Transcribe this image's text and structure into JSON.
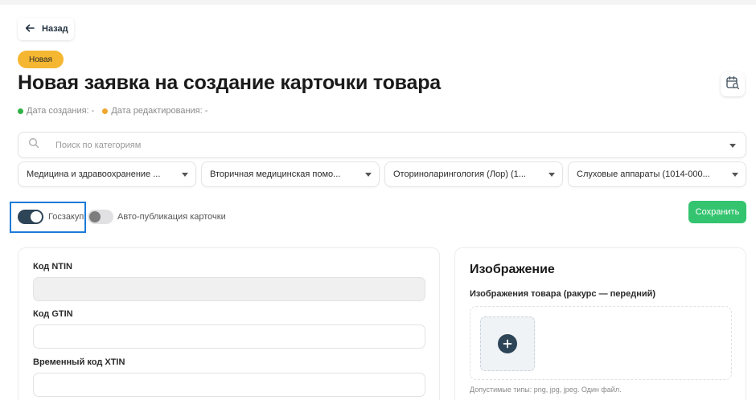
{
  "header": {
    "back_label": "Назад",
    "status_badge": "Новая",
    "title": "Новая заявка на создание карточки товара",
    "created_label": "Дата создания: -",
    "edited_label": "Дата редактирования: -"
  },
  "colors": {
    "status_badge": "#f5b731",
    "created_dot": "#2fb344",
    "edited_dot": "#f0a72f",
    "save_button": "#34c46f",
    "toggle_on": "#2e4457",
    "focus_outline": "#1a7bd8"
  },
  "search": {
    "placeholder": "Поиск по категориям",
    "value": ""
  },
  "categories": [
    "Медицина и здравоохранение ...",
    "Вторичная медицинская помо...",
    "Оториноларингология (Лор) (1...",
    "Слуховые аппараты (1014-000..."
  ],
  "toggles": {
    "goszakup": {
      "label": "Госзакуп",
      "on": true
    },
    "autopublish": {
      "label": "Авто-публикация карточки",
      "on": false
    }
  },
  "save_label": "Сохранить",
  "form": {
    "ntin_label": "Код NTIN",
    "ntin_value": "",
    "gtin_label": "Код GTIN",
    "gtin_value": "",
    "xtin_label": "Временный код XTIN",
    "xtin_value": ""
  },
  "image_section": {
    "title": "Изображение",
    "subtitle": "Изображения товара (ракурс — передний)",
    "hint": "Допустимые типы: png, jpg, jpeg. Один файл."
  },
  "icons": {
    "back": "arrow-left-icon",
    "calendar": "calendar-search-icon",
    "search": "search-icon",
    "dropdown": "chevron-down-icon",
    "add": "plus-icon"
  }
}
